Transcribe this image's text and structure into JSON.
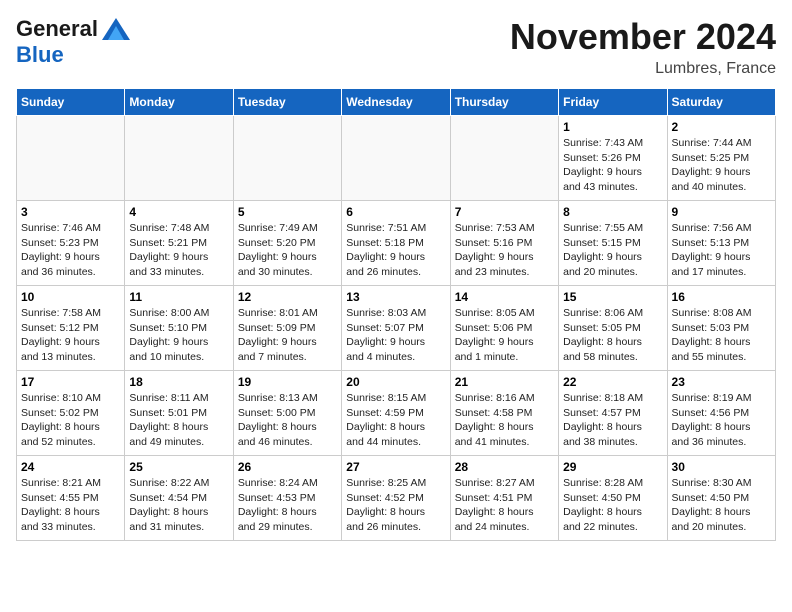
{
  "header": {
    "logo_line1": "General",
    "logo_line2": "Blue",
    "month": "November 2024",
    "location": "Lumbres, France"
  },
  "weekdays": [
    "Sunday",
    "Monday",
    "Tuesday",
    "Wednesday",
    "Thursday",
    "Friday",
    "Saturday"
  ],
  "weeks": [
    [
      {
        "day": "",
        "info": ""
      },
      {
        "day": "",
        "info": ""
      },
      {
        "day": "",
        "info": ""
      },
      {
        "day": "",
        "info": ""
      },
      {
        "day": "",
        "info": ""
      },
      {
        "day": "1",
        "info": "Sunrise: 7:43 AM\nSunset: 5:26 PM\nDaylight: 9 hours\nand 43 minutes."
      },
      {
        "day": "2",
        "info": "Sunrise: 7:44 AM\nSunset: 5:25 PM\nDaylight: 9 hours\nand 40 minutes."
      }
    ],
    [
      {
        "day": "3",
        "info": "Sunrise: 7:46 AM\nSunset: 5:23 PM\nDaylight: 9 hours\nand 36 minutes."
      },
      {
        "day": "4",
        "info": "Sunrise: 7:48 AM\nSunset: 5:21 PM\nDaylight: 9 hours\nand 33 minutes."
      },
      {
        "day": "5",
        "info": "Sunrise: 7:49 AM\nSunset: 5:20 PM\nDaylight: 9 hours\nand 30 minutes."
      },
      {
        "day": "6",
        "info": "Sunrise: 7:51 AM\nSunset: 5:18 PM\nDaylight: 9 hours\nand 26 minutes."
      },
      {
        "day": "7",
        "info": "Sunrise: 7:53 AM\nSunset: 5:16 PM\nDaylight: 9 hours\nand 23 minutes."
      },
      {
        "day": "8",
        "info": "Sunrise: 7:55 AM\nSunset: 5:15 PM\nDaylight: 9 hours\nand 20 minutes."
      },
      {
        "day": "9",
        "info": "Sunrise: 7:56 AM\nSunset: 5:13 PM\nDaylight: 9 hours\nand 17 minutes."
      }
    ],
    [
      {
        "day": "10",
        "info": "Sunrise: 7:58 AM\nSunset: 5:12 PM\nDaylight: 9 hours\nand 13 minutes."
      },
      {
        "day": "11",
        "info": "Sunrise: 8:00 AM\nSunset: 5:10 PM\nDaylight: 9 hours\nand 10 minutes."
      },
      {
        "day": "12",
        "info": "Sunrise: 8:01 AM\nSunset: 5:09 PM\nDaylight: 9 hours\nand 7 minutes."
      },
      {
        "day": "13",
        "info": "Sunrise: 8:03 AM\nSunset: 5:07 PM\nDaylight: 9 hours\nand 4 minutes."
      },
      {
        "day": "14",
        "info": "Sunrise: 8:05 AM\nSunset: 5:06 PM\nDaylight: 9 hours\nand 1 minute."
      },
      {
        "day": "15",
        "info": "Sunrise: 8:06 AM\nSunset: 5:05 PM\nDaylight: 8 hours\nand 58 minutes."
      },
      {
        "day": "16",
        "info": "Sunrise: 8:08 AM\nSunset: 5:03 PM\nDaylight: 8 hours\nand 55 minutes."
      }
    ],
    [
      {
        "day": "17",
        "info": "Sunrise: 8:10 AM\nSunset: 5:02 PM\nDaylight: 8 hours\nand 52 minutes."
      },
      {
        "day": "18",
        "info": "Sunrise: 8:11 AM\nSunset: 5:01 PM\nDaylight: 8 hours\nand 49 minutes."
      },
      {
        "day": "19",
        "info": "Sunrise: 8:13 AM\nSunset: 5:00 PM\nDaylight: 8 hours\nand 46 minutes."
      },
      {
        "day": "20",
        "info": "Sunrise: 8:15 AM\nSunset: 4:59 PM\nDaylight: 8 hours\nand 44 minutes."
      },
      {
        "day": "21",
        "info": "Sunrise: 8:16 AM\nSunset: 4:58 PM\nDaylight: 8 hours\nand 41 minutes."
      },
      {
        "day": "22",
        "info": "Sunrise: 8:18 AM\nSunset: 4:57 PM\nDaylight: 8 hours\nand 38 minutes."
      },
      {
        "day": "23",
        "info": "Sunrise: 8:19 AM\nSunset: 4:56 PM\nDaylight: 8 hours\nand 36 minutes."
      }
    ],
    [
      {
        "day": "24",
        "info": "Sunrise: 8:21 AM\nSunset: 4:55 PM\nDaylight: 8 hours\nand 33 minutes."
      },
      {
        "day": "25",
        "info": "Sunrise: 8:22 AM\nSunset: 4:54 PM\nDaylight: 8 hours\nand 31 minutes."
      },
      {
        "day": "26",
        "info": "Sunrise: 8:24 AM\nSunset: 4:53 PM\nDaylight: 8 hours\nand 29 minutes."
      },
      {
        "day": "27",
        "info": "Sunrise: 8:25 AM\nSunset: 4:52 PM\nDaylight: 8 hours\nand 26 minutes."
      },
      {
        "day": "28",
        "info": "Sunrise: 8:27 AM\nSunset: 4:51 PM\nDaylight: 8 hours\nand 24 minutes."
      },
      {
        "day": "29",
        "info": "Sunrise: 8:28 AM\nSunset: 4:50 PM\nDaylight: 8 hours\nand 22 minutes."
      },
      {
        "day": "30",
        "info": "Sunrise: 8:30 AM\nSunset: 4:50 PM\nDaylight: 8 hours\nand 20 minutes."
      }
    ]
  ]
}
